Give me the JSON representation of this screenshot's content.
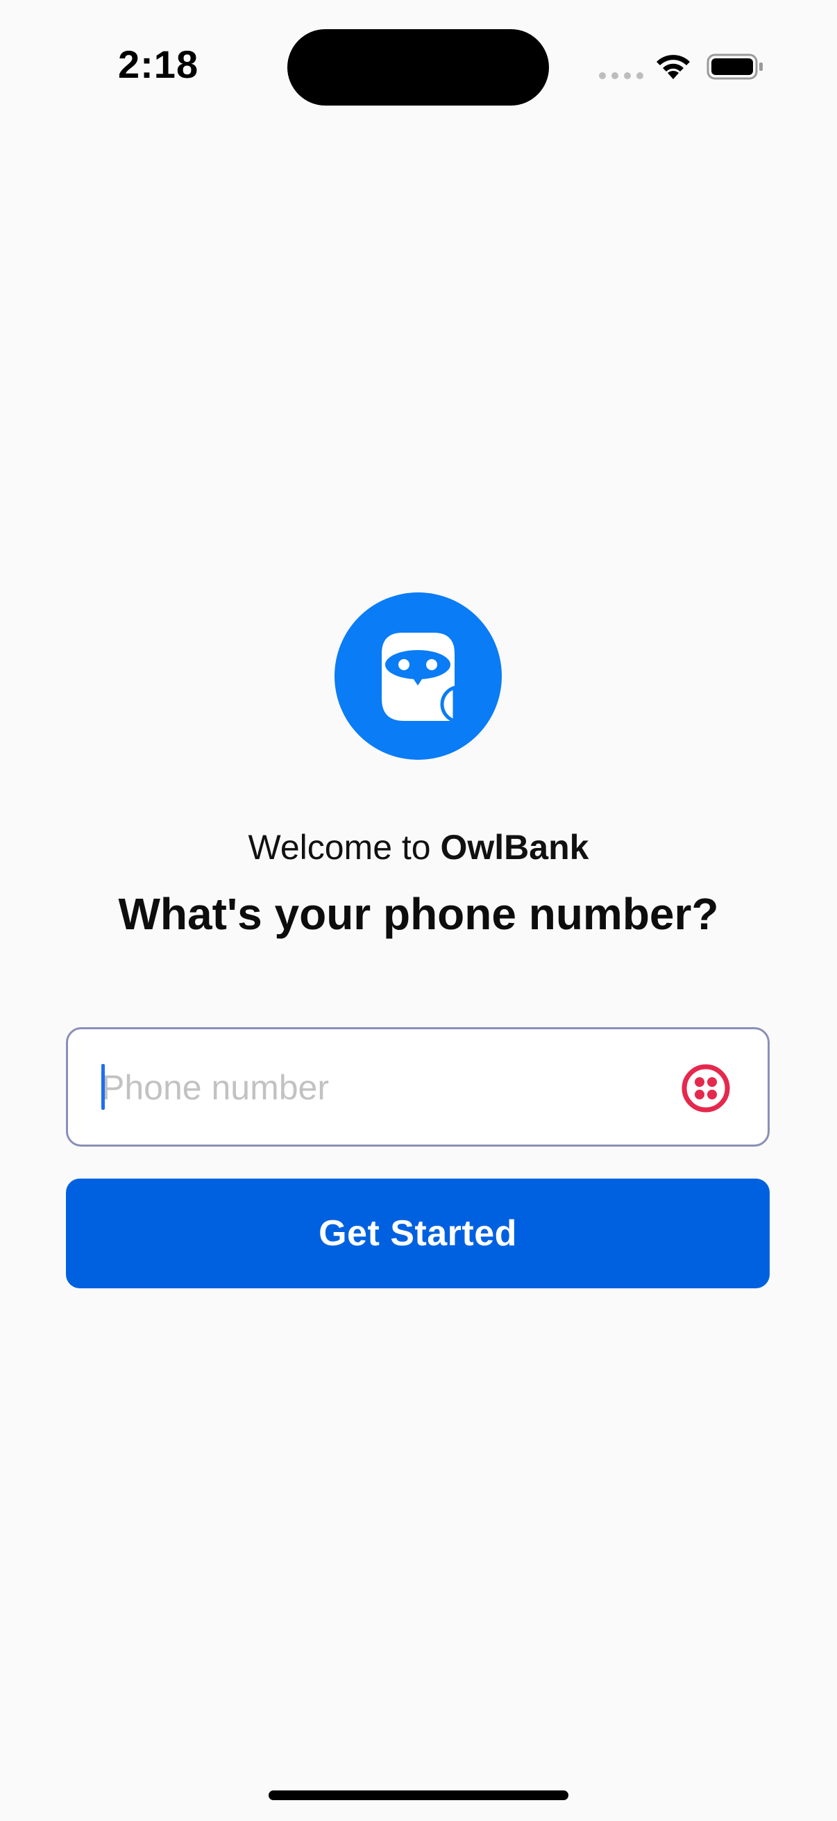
{
  "status_bar": {
    "time": "2:18"
  },
  "brand": {
    "welcome_prefix": "Welcome to ",
    "app_name": "OwlBank",
    "logo_icon": "owl-icon",
    "accent_color": "#0a7cf5"
  },
  "prompt": {
    "question": "What's your phone number?"
  },
  "phone_input": {
    "placeholder": "Phone number",
    "value": "",
    "trailing_icon": "twilio-icon",
    "trailing_icon_color": "#e5284d"
  },
  "primary_button": {
    "label": "Get Started",
    "color": "#0061e0"
  }
}
